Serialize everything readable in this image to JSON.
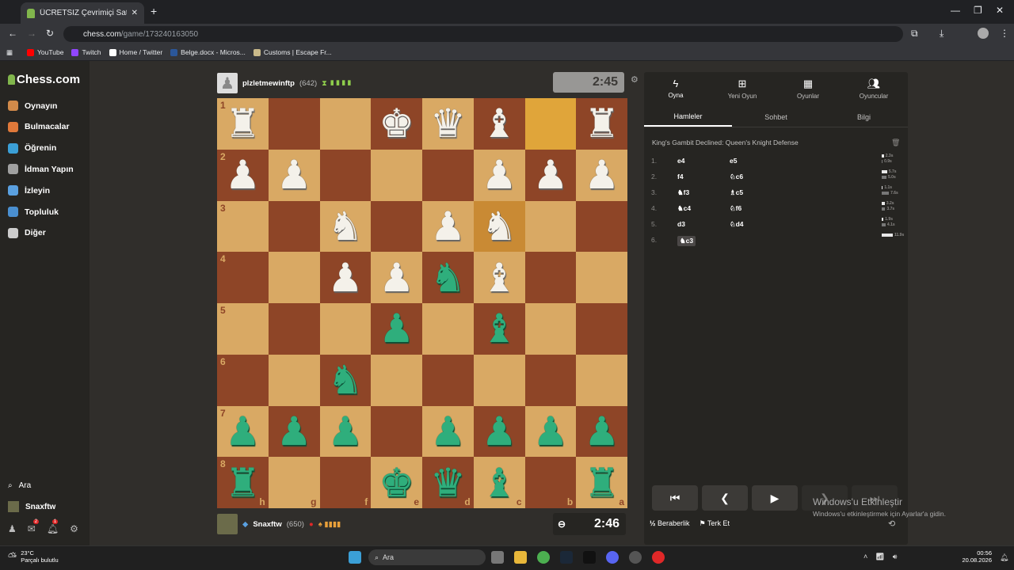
{
  "browser": {
    "tab_title": "ÜCRETSİZ Çevrimiçi Satranç",
    "url_host": "chess.com",
    "url_path": "/game/173240163050",
    "bookmarks": [
      {
        "label": "YouTube",
        "color": "#ff0000"
      },
      {
        "label": "Twitch",
        "color": "#9146ff"
      },
      {
        "label": "Home / Twitter",
        "color": "#ffffff"
      },
      {
        "label": "Belge.docx - Micros...",
        "color": "#2b579a"
      },
      {
        "label": "Customs | Escape Fr...",
        "color": "#c9b98a"
      }
    ]
  },
  "sidebar": {
    "logo": "Chess.com",
    "items": [
      {
        "label": "Oynayın",
        "color": "#d18a4a"
      },
      {
        "label": "Bulmacalar",
        "color": "#e0793a"
      },
      {
        "label": "Öğrenin",
        "color": "#3b9fd6"
      },
      {
        "label": "İdman Yapın",
        "color": "#a0a0a0"
      },
      {
        "label": "İzleyin",
        "color": "#5aa0e0"
      },
      {
        "label": "Topluluk",
        "color": "#4a8fd0"
      },
      {
        "label": "Diğer",
        "color": "#cccccc"
      }
    ],
    "search_label": "Ara",
    "user": "Snaxftw",
    "badges": [
      "2",
      "1"
    ]
  },
  "top_player": {
    "name": "plzletmewinftp",
    "rating": "(642)",
    "clock": "2:45"
  },
  "bottom_player": {
    "name": "Snaxftw",
    "rating": "(650)",
    "clock": "2:46"
  },
  "board": {
    "ranks": [
      "1",
      "2",
      "3",
      "4",
      "5",
      "6",
      "7",
      "8"
    ],
    "files": [
      "h",
      "g",
      "f",
      "e",
      "d",
      "c",
      "b",
      "a"
    ],
    "rows": [
      [
        "wR",
        "",
        "",
        "wK",
        "wQ",
        "wB",
        "*",
        "wR"
      ],
      [
        "wP",
        "wP",
        "",
        "",
        "",
        "wP",
        "wP",
        "wP"
      ],
      [
        "",
        "",
        "wN",
        "",
        "wP",
        "wN*",
        "",
        ""
      ],
      [
        "",
        "",
        "wP",
        "wP",
        "gN",
        "wB",
        "",
        ""
      ],
      [
        "",
        "",
        "",
        "gP",
        "",
        "gB",
        "",
        ""
      ],
      [
        "",
        "",
        "gN",
        "",
        "",
        "",
        "",
        ""
      ],
      [
        "gP",
        "gP",
        "gP",
        "",
        "gP",
        "gP",
        "gP",
        "gP"
      ],
      [
        "gR",
        "",
        "",
        "gK",
        "gQ",
        "gB",
        "",
        "gR"
      ]
    ]
  },
  "panel": {
    "tabs": [
      "Oyna",
      "Yeni Oyun",
      "Oyunlar",
      "Oyuncular"
    ],
    "subtabs": [
      "Hamleler",
      "Sohbet",
      "Bilgi"
    ],
    "opening": "King's Gambit Declined: Queen's Knight Defense",
    "moves": [
      {
        "n": "1.",
        "w": "e4",
        "b": "e5",
        "tw": "2.3s",
        "tb": "0.9s"
      },
      {
        "n": "2.",
        "w": "f4",
        "b": "♘c6",
        "tw": "5.7s",
        "tb": "5.0s"
      },
      {
        "n": "3.",
        "w": "♞f3",
        "b": "♗c5",
        "tw": "1.1s",
        "tb": "7.6s"
      },
      {
        "n": "4.",
        "w": "♞c4",
        "b": "♘f6",
        "tw": "3.2s",
        "tb": "3.7s"
      },
      {
        "n": "5.",
        "w": "d3",
        "b": "♘d4",
        "tw": "1.9s",
        "tb": "4.1s"
      },
      {
        "n": "6.",
        "w": "♞c3",
        "b": "",
        "tw": "11.9s",
        "tb": ""
      }
    ],
    "draw": "Beraberlik",
    "resign": "Terk Et"
  },
  "watermark": {
    "title": "Windows'u Etkinleştir",
    "sub": "Windows'u etkinleştirmek için Ayarlar'a gidin."
  },
  "taskbar": {
    "temp": "23°C",
    "weather": "Parçalı bulutlu",
    "search": "Ara",
    "time": "00:56",
    "date": "20.08.2026"
  }
}
